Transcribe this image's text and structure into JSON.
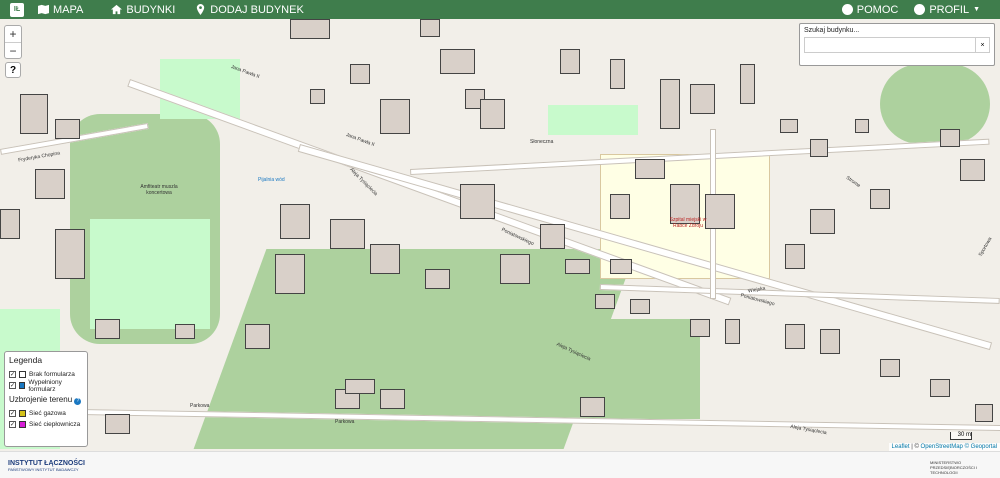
{
  "nav": {
    "mapa": "MAPA",
    "budynki": "BUDYNKI",
    "dodaj": "DODAJ BUDYNEK",
    "pomoc": "POMOC",
    "profil": "PROFIL"
  },
  "zoom": {
    "in": "+",
    "out": "−"
  },
  "help": "?",
  "search": {
    "label": "Szukaj budynku...",
    "placeholder": "",
    "clear": "×"
  },
  "legend": {
    "title": "Legenda",
    "items": [
      {
        "label": "Brak formularza",
        "color": "#ffffff"
      },
      {
        "label": "Wypełniony formularz",
        "color": "#1a78c2"
      }
    ],
    "section": "Uzbrojenie terenu",
    "layers": [
      {
        "label": "Sieć gazowa",
        "color": "#d4c21a"
      },
      {
        "label": "Sieć ciepłownicza",
        "color": "#d51cd5"
      }
    ]
  },
  "map_labels": {
    "l1": "Fryderyka Chopina",
    "l2": "Jana Pawła II",
    "l3": "Aleja Tysiąclecia",
    "l4": "Słoneczna",
    "l5": "Poniatowskiego",
    "l6": "Wiejska",
    "l7": "Parkowa",
    "l8": "Szpital miejski w Rabce Zdroju",
    "l9": "Amfiteatr muszla koncertowa",
    "l10": "Pijalnia wód",
    "l11": "Aleja Tysiąclecia",
    "l12": "Strome",
    "l13": "Sportowa"
  },
  "attribution": {
    "leaflet": "Leaflet",
    "sep": " | © ",
    "osm": "OpenStreetMap",
    "geo": "© Geoportal"
  },
  "scale": "30 m",
  "footer": {
    "org": "INSTYTUT ŁĄCZNOŚCI",
    "org_sub": "PAŃSTWOWY INSTYTUT BADAWCZY",
    "ministry": "MINISTERSTWO PRZEDSIĘBIORCZOŚCI I TECHNOLOGII"
  },
  "colors": {
    "brand": "#3f7d4c",
    "forest": "#add19e",
    "park": "#c8facc",
    "hospital": "#ffffe5"
  }
}
